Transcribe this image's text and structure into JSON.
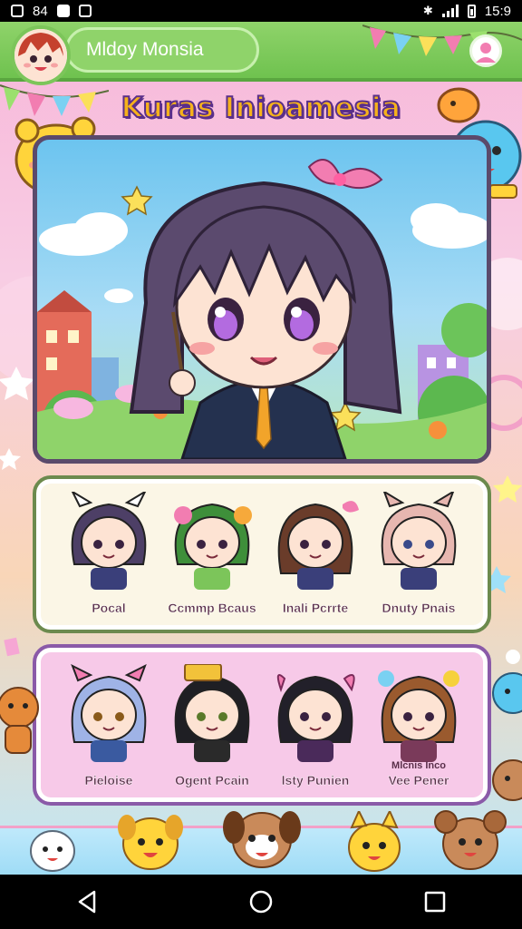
{
  "status_bar": {
    "left_icons": [
      "image-icon",
      "photo-icon",
      "message-icon",
      "download-icon"
    ],
    "left_text": "84",
    "time": "15:9"
  },
  "header": {
    "user_name": "Mldoy Monsia",
    "title": "Kuras Inioamesia"
  },
  "roster_row_1": [
    {
      "name": "Pocal",
      "hair": "#4d3f66"
    },
    {
      "name": "Ccmmp Bcaus",
      "hair": "#3e8f3a"
    },
    {
      "name": "Inali Pcrrte",
      "hair": "#6a3c2a"
    },
    {
      "name": "Dnuty Pnais",
      "hair": "#e7b7b0"
    }
  ],
  "roster_row_2": [
    {
      "name": "Pieloise",
      "sub": "",
      "hair": "#9fb3e6"
    },
    {
      "name": "Ogent Pcain",
      "sub": "",
      "hair": "#1f1f24"
    },
    {
      "name": "lsty Punien",
      "sub": "",
      "hair": "#22202a"
    },
    {
      "name": "Vee Pener",
      "sub": "Mlcnis Inco",
      "hair": "#9a5a2e"
    }
  ],
  "colors": {
    "accent_green": "#8fd36a",
    "title_fill": "#f6b21b",
    "title_outline": "#5a2f8a"
  }
}
